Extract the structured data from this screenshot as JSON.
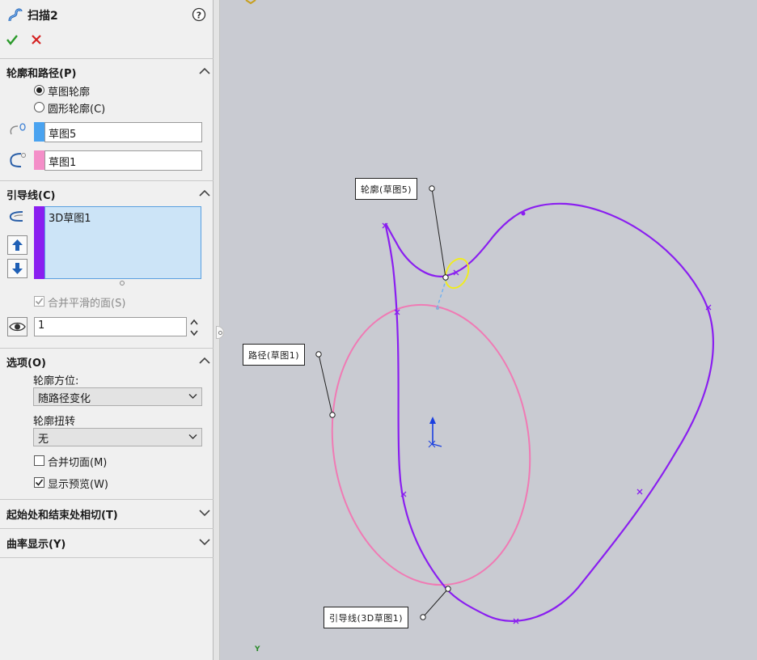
{
  "header": {
    "title": "扫描2",
    "top_canvas_text": "…"
  },
  "sections": {
    "profile_path": {
      "title": "轮廓和路径(P)",
      "radio_sketch_profile": "草图轮廓",
      "radio_circular_profile": "圆形轮廓(C)",
      "profile_value": "草图5",
      "path_value": "草图1",
      "profile_color": "#4aa3f0",
      "path_color": "#f48ec8"
    },
    "guide_curves": {
      "title": "引导线(C)",
      "list_items": [
        "3D草图1"
      ],
      "list_color": "#8a1ef0",
      "merge_smooth_faces": "合并平滑的面(S)",
      "merge_smooth_checked": true,
      "section_count": "1"
    },
    "options": {
      "title": "选项(O)",
      "orientation_label": "轮廓方位:",
      "orientation_value": "随路径变化",
      "twist_label": "轮廓扭转",
      "twist_value": "无",
      "merge_tangent_faces": "合并切面(M)",
      "merge_tangent_checked": false,
      "show_preview": "显示预览(W)",
      "show_preview_checked": true
    },
    "start_end_tangency": {
      "title": "起始处和结束处相切(T)"
    },
    "curvature_display": {
      "title": "曲率显示(Y)"
    }
  },
  "canvas": {
    "callout_profile": "轮廓(草图5)",
    "callout_path": "路径(草图1)",
    "callout_guide": "引导线(3D草图1)",
    "guide_color": "#8a1ef0",
    "path_color": "#f07ab4",
    "axis_label": "Y"
  }
}
